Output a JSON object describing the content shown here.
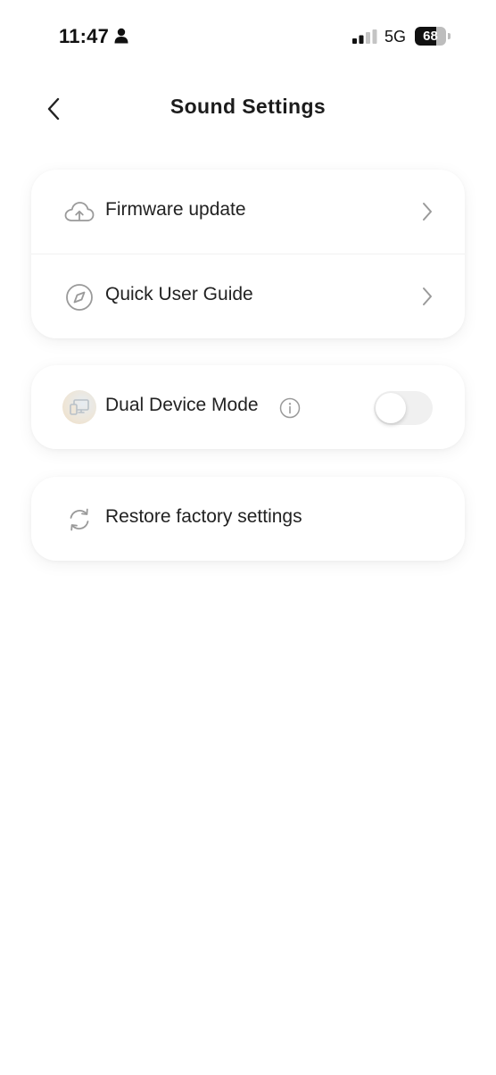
{
  "status_bar": {
    "time": "11:47",
    "network": "5G",
    "battery_level": "68",
    "battery_fraction": 0.68
  },
  "header": {
    "title": "Sound Settings",
    "back_icon": "chevron-left-icon"
  },
  "sections": [
    {
      "items": [
        {
          "label": "Firmware update",
          "icon": "cloud-upload-icon",
          "trailing": "chevron-right-icon"
        },
        {
          "label": "Quick User Guide",
          "icon": "compass-icon",
          "trailing": "chevron-right-icon"
        }
      ]
    },
    {
      "items": [
        {
          "label": "Dual Device Mode",
          "icon": "dual-device-icon",
          "info_icon": "info-icon",
          "toggle_on": false
        }
      ]
    },
    {
      "items": [
        {
          "label": "Restore factory settings",
          "icon": "refresh-icon"
        }
      ]
    }
  ],
  "colors": {
    "icon_gray": "#9a9a9a",
    "text": "#222222",
    "toggle_off_track": "#f0f0f0"
  }
}
